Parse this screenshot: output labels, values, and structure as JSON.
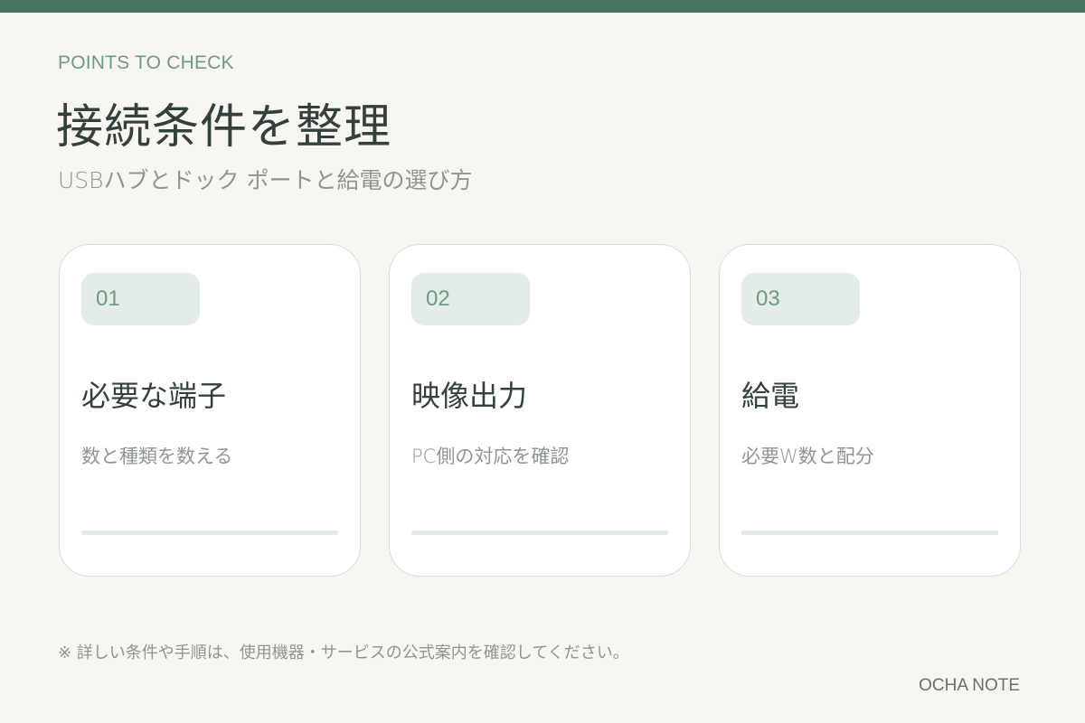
{
  "header": {
    "eyebrow": "POINTS TO CHECK",
    "title": "接続条件を整理",
    "subtitle": "USBハブとドック ポートと給電の選び方"
  },
  "cards": [
    {
      "number": "01",
      "title": "必要な端子",
      "description": "数と種類を数える"
    },
    {
      "number": "02",
      "title": "映像出力",
      "description": "PC側の対応を確認"
    },
    {
      "number": "03",
      "title": "給電",
      "description": "必要W数と配分"
    }
  ],
  "footer": {
    "note": "※ 詳しい条件や手順は、使用機器・サービスの公式案内を確認してください。",
    "brand": "OCHA NOTE"
  },
  "colors": {
    "accent": "#477560",
    "accent_light": "#6f9a84",
    "badge_bg": "#e3ece6",
    "background": "#f7f6f1"
  }
}
